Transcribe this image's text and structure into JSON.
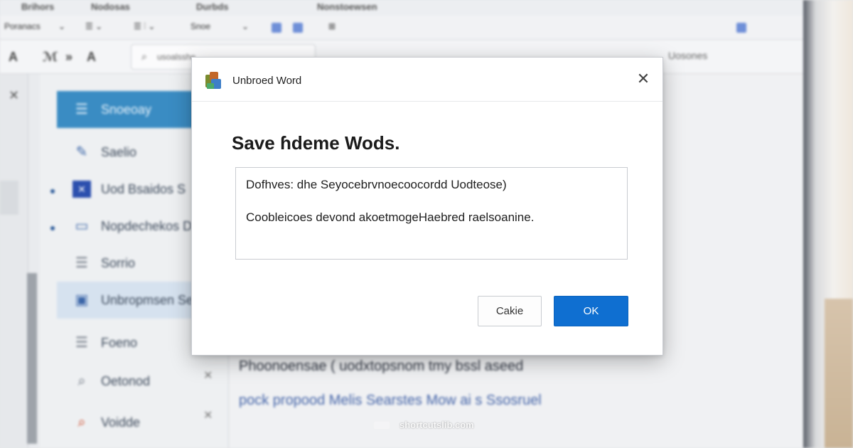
{
  "background_app": {
    "menu": [
      "Brihors",
      "Nodosas",
      "Durbds",
      "Nonstoewsen"
    ],
    "toolbar": {
      "style_label": "Poranacs",
      "size_label": "Snoe"
    },
    "ribbon_glyphs": [
      "A",
      "ℳ",
      "»",
      "A"
    ],
    "search": {
      "placeholder": "usoalsshe",
      "right_text": "Uosones"
    },
    "sidebar": {
      "items": [
        {
          "label": "Snoeoay",
          "icon": "list-icon",
          "state": "active"
        },
        {
          "label": "Saelio",
          "icon": "edit-icon",
          "state": "normal"
        },
        {
          "label": "Uod Bsaidos S",
          "icon": "image-icon",
          "state": "normal"
        },
        {
          "label": "Nopdechekos D",
          "icon": "monitor-icon",
          "state": "normal"
        },
        {
          "label": "Sorrio",
          "icon": "list-icon",
          "state": "normal"
        },
        {
          "label": "Unbropmsen Se",
          "icon": "tablet-icon",
          "state": "selected"
        },
        {
          "label": "Foeno",
          "icon": "list-icon",
          "state": "normal"
        },
        {
          "label": "Oetonod",
          "icon": "search-icon",
          "state": "normal"
        },
        {
          "label": "Voidde",
          "icon": "search-icon",
          "state": "normal"
        }
      ]
    },
    "content": {
      "line1": "Phoonoensae ( uodxtopsnom tmy bssl aseed",
      "line2": "pock propood Melis Searstes  Mow ai s Ssosruel"
    }
  },
  "dialog": {
    "app_title": "Unbroed Word",
    "close_glyph": "✕",
    "heading": "Save ɦdeme Wods.",
    "text_line1": "Dofhves:  dhe  Seyocebrvnoecoocordd Uodteose)",
    "text_line2": "Coobleicoes  devond  akoetmogeHaebred raelsoanine.",
    "cancel_label": "Cakie",
    "ok_label": "OK",
    "accent_color": "#0f6fd1"
  },
  "watermark": {
    "text": "shortcutslib.com",
    "icon": "keyboard-icon"
  }
}
